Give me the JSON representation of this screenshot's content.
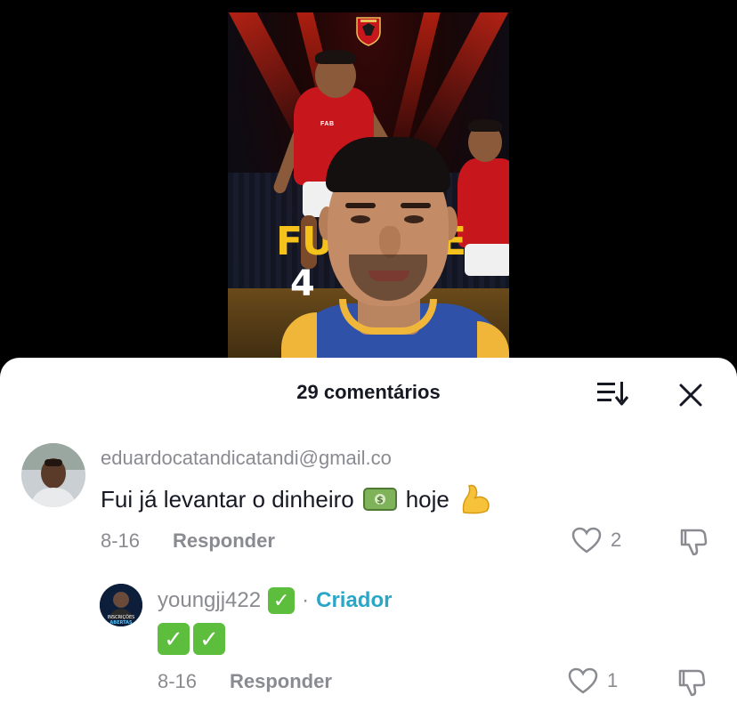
{
  "video": {
    "overlay_title_left": "FU",
    "overlay_title_right": "E",
    "overlay_number_left": "4",
    "overlay_number_right": "",
    "sponsor": "FAB"
  },
  "sheet": {
    "title": "29 comentários",
    "sort_icon": "sort-icon",
    "close_icon": "close-icon"
  },
  "comments": [
    {
      "username": "eduardocatandicatandi@gmail.co",
      "text_before": "Fui já levantar o dinheiro",
      "text_after": "hoje",
      "emojis": [
        "money-emoji",
        "flexed-biceps-emoji"
      ],
      "date": "8-16",
      "reply_label": "Responder",
      "likes": "2"
    },
    {
      "username": "youngjj422",
      "separator": "·",
      "creator_label": "Criador",
      "avatar_text_1": "INSCRIÇÕES",
      "avatar_text_2": "ABERTAS",
      "text_emojis": [
        "check-mark-emoji",
        "check-mark-emoji"
      ],
      "date": "8-16",
      "reply_label": "Responder",
      "likes": "1"
    }
  ],
  "colors": {
    "text_primary": "#161823",
    "text_secondary": "#8a8b91",
    "creator": "#2aa6c6",
    "check_green": "#5cbe3c",
    "club_red": "#c8161d",
    "title_yellow": "#f4c21a"
  }
}
